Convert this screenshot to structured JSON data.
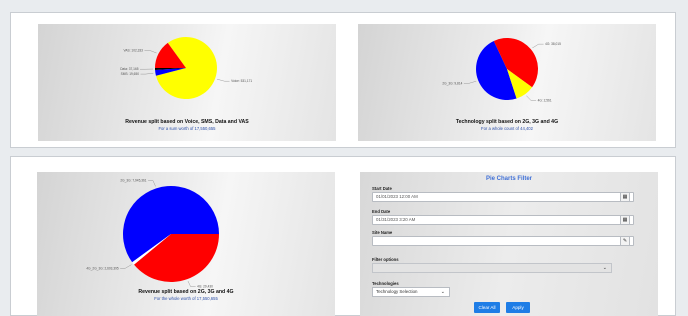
{
  "chart_data": [
    {
      "type": "pie",
      "title": "Revenue split based on Voice, SMS, Data and VAS",
      "subtitle": "For a sum worth of 17,550,655",
      "categories": [
        "Voice",
        "SMS",
        "Data",
        "VAS"
      ],
      "values": [
        81,
        3,
        1,
        15
      ],
      "slice_labels": [
        "Voice: 531,171",
        "SMS: 19,650",
        "Data: 37,165",
        "VAS: 102,333"
      ],
      "colors": [
        "#ffff00",
        "#0000ff",
        "#000000",
        "#ff0000"
      ]
    },
    {
      "type": "pie",
      "title": "Technology split based on 2G, 3G and 4G",
      "subtitle": "For a whole count of 44,402",
      "categories": [
        "2G",
        "3G",
        "4G"
      ],
      "values": [
        48,
        42,
        10
      ],
      "slice_labels": [
        "2G_3G: 9,814",
        "4G: 38,015",
        "4G: 2,561"
      ],
      "colors": [
        "#0000ff",
        "#ff0000",
        "#ffff00"
      ]
    },
    {
      "type": "pie",
      "title": "Revenue split based on 2G, 3G and 4G",
      "subtitle": "For the whole worth of 17,550,655",
      "categories": [
        "2G/3G",
        "4G",
        "other"
      ],
      "values": [
        60,
        39,
        1
      ],
      "slice_labels": [
        "2G_3G: 7,945,361",
        "4G: 29,430",
        "4G_2G_3G: 2,603,395"
      ],
      "colors": [
        "#0000ff",
        "#ff0000",
        "#ffffff"
      ]
    }
  ],
  "filter": {
    "title": "Pie Charts Filter",
    "start_label": "Start Date",
    "start_value": "01/01/2023 12:00 AM",
    "end_label": "End Date",
    "end_value": "01/31/2023 3:20 AM",
    "site_label": "Site Name",
    "site_value": "",
    "options_label": "Filter options",
    "options_value": "",
    "tech_label": "Technologies",
    "tech_value": "Technology Selection",
    "clear_label": "Clear All",
    "apply_label": "Apply",
    "calendar_icon": "▦",
    "edit_icon": "✎",
    "caret_icon": "⌄"
  }
}
